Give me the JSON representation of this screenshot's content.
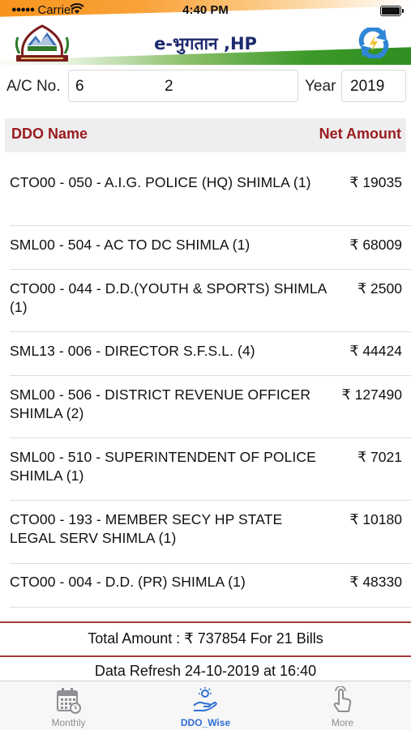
{
  "status_bar": {
    "carrier": "Carrier",
    "time": "4:40 PM"
  },
  "header": {
    "title": "e-भुगतान ,HP",
    "emblem_icon": "hp-government-emblem",
    "refresh_icon": "refresh-icon"
  },
  "account": {
    "label": "A/C No.",
    "value_part1": "6",
    "value_part2": "2",
    "year_label": "Year",
    "year_value": "2019"
  },
  "table": {
    "columns": [
      "DDO Name",
      "Net Amount"
    ],
    "rows": [
      {
        "name": "CTO00 - 050 - A.I.G. POLICE (HQ) SHIMLA (1)",
        "amount": "₹ 19035"
      },
      {
        "name": "SML00 - 504 - AC TO DC SHIMLA (1)",
        "amount": "₹ 68009"
      },
      {
        "name": "CTO00 - 044 - D.D.(YOUTH & SPORTS) SHIMLA (1)",
        "amount": "₹ 2500"
      },
      {
        "name": "SML13 - 006 - DIRECTOR S.F.S.L. (4)",
        "amount": "₹ 44424"
      },
      {
        "name": "SML00 - 506 - DISTRICT REVENUE OFFICER SHIMLA (2)",
        "amount": "₹ 127490"
      },
      {
        "name": "SML00 - 510 - SUPERINTENDENT OF POLICE SHIMLA (1)",
        "amount": "₹ 7021"
      },
      {
        "name": "CTO00 - 193 - MEMBER SECY HP STATE LEGAL SERV SHIMLA (1)",
        "amount": "₹ 10180"
      },
      {
        "name": "CTO00 - 004 - D.D. (PR) SHIMLA (1)",
        "amount": "₹ 48330"
      }
    ]
  },
  "summary": {
    "total_text": "Total Amount : ₹ 737854 For 21 Bills",
    "refresh_text": "Data Refresh 24-10-2019 at 16:40"
  },
  "tabs": [
    {
      "label": "Monthly",
      "icon": "calendar-icon",
      "active": false
    },
    {
      "label": "DDO_Wise",
      "icon": "hand-money-icon",
      "active": true
    },
    {
      "label": "More",
      "icon": "tap-finger-icon",
      "active": false
    }
  ],
  "colors": {
    "accent": "#2f6fd6",
    "header_text": "#9b1c20",
    "title": "#1d2a6e",
    "divider": "#a33a3a"
  }
}
